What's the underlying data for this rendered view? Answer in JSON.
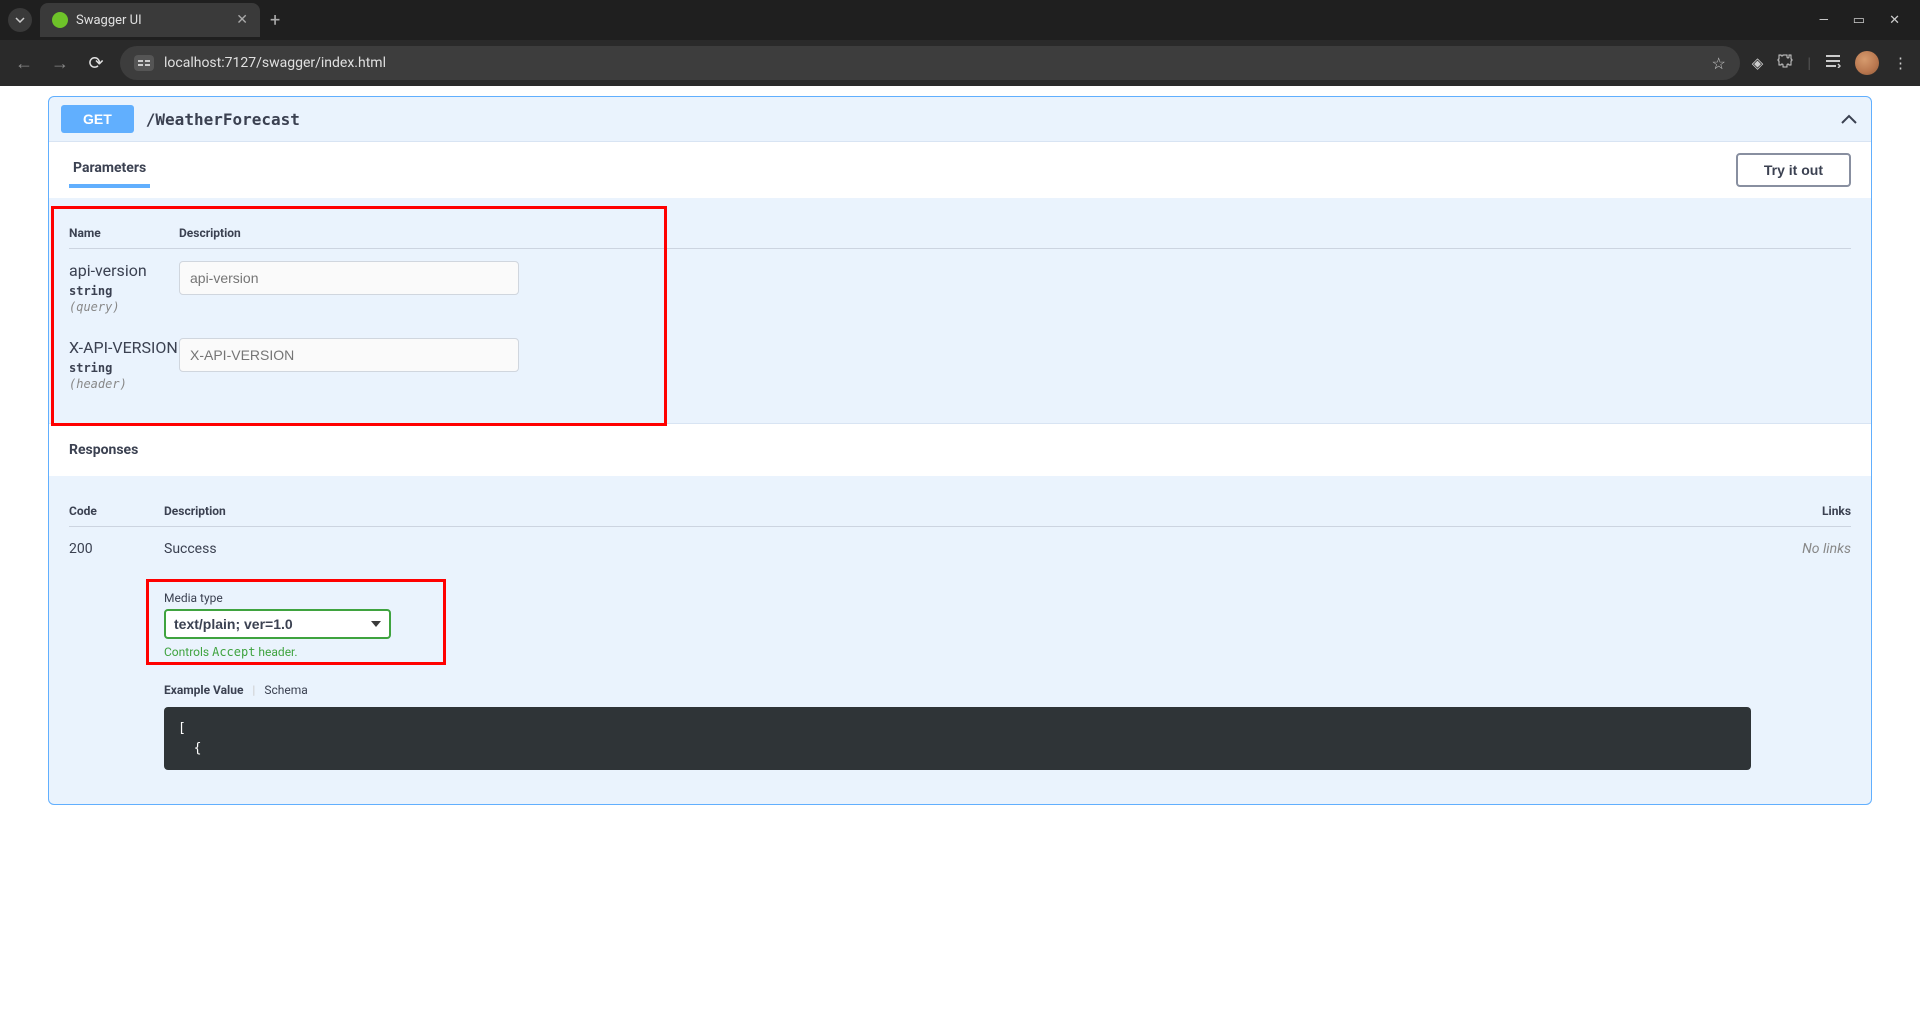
{
  "browser": {
    "tab_title": "Swagger UI",
    "url": "localhost:7127/swagger/index.html"
  },
  "operation": {
    "method": "GET",
    "path": "/WeatherForecast",
    "parameters_tab": "Parameters",
    "try_it_out": "Try it out",
    "param_headers": {
      "name": "Name",
      "description": "Description"
    },
    "params": [
      {
        "name": "api-version",
        "type": "string",
        "in": "query",
        "placeholder": "api-version"
      },
      {
        "name": "X-API-VERSION",
        "type": "string",
        "in": "header",
        "placeholder": "X-API-VERSION"
      }
    ],
    "responses_label": "Responses",
    "resp_headers": {
      "code": "Code",
      "description": "Description",
      "links": "Links"
    },
    "response": {
      "code": "200",
      "description": "Success",
      "no_links": "No links",
      "media_type_label": "Media type",
      "media_type_value": "text/plain; ver=1.0",
      "accept_hint_pre": "Controls ",
      "accept_hint_code": "Accept",
      "accept_hint_post": " header.",
      "example_tab_active": "Example Value",
      "example_tab_other": "Schema",
      "code_line1": "[",
      "code_line2": "  {"
    }
  }
}
